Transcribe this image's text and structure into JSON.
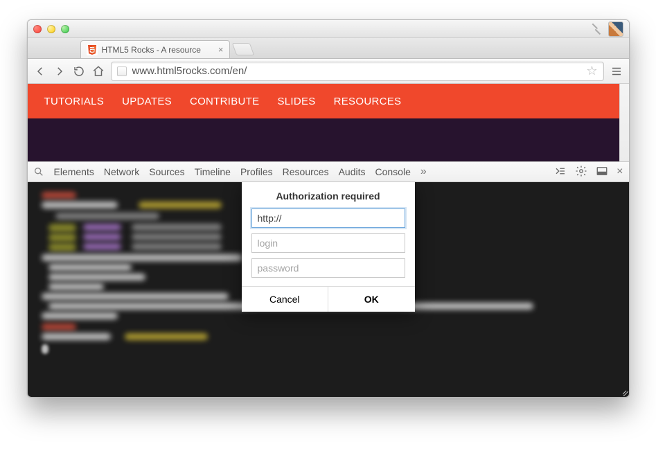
{
  "window": {
    "tab_title": "HTML5 Rocks - A resource",
    "url": "www.html5rocks.com/en/"
  },
  "site_nav": {
    "items": [
      "TUTORIALS",
      "UPDATES",
      "CONTRIBUTE",
      "SLIDES",
      "RESOURCES"
    ]
  },
  "devtools": {
    "tabs": [
      "Elements",
      "Network",
      "Sources",
      "Timeline",
      "Profiles",
      "Resources",
      "Audits",
      "Console"
    ]
  },
  "dialog": {
    "title": "Authorization required",
    "url_value": "http://",
    "login_placeholder": "login",
    "password_placeholder": "password",
    "cancel": "Cancel",
    "ok": "OK"
  }
}
